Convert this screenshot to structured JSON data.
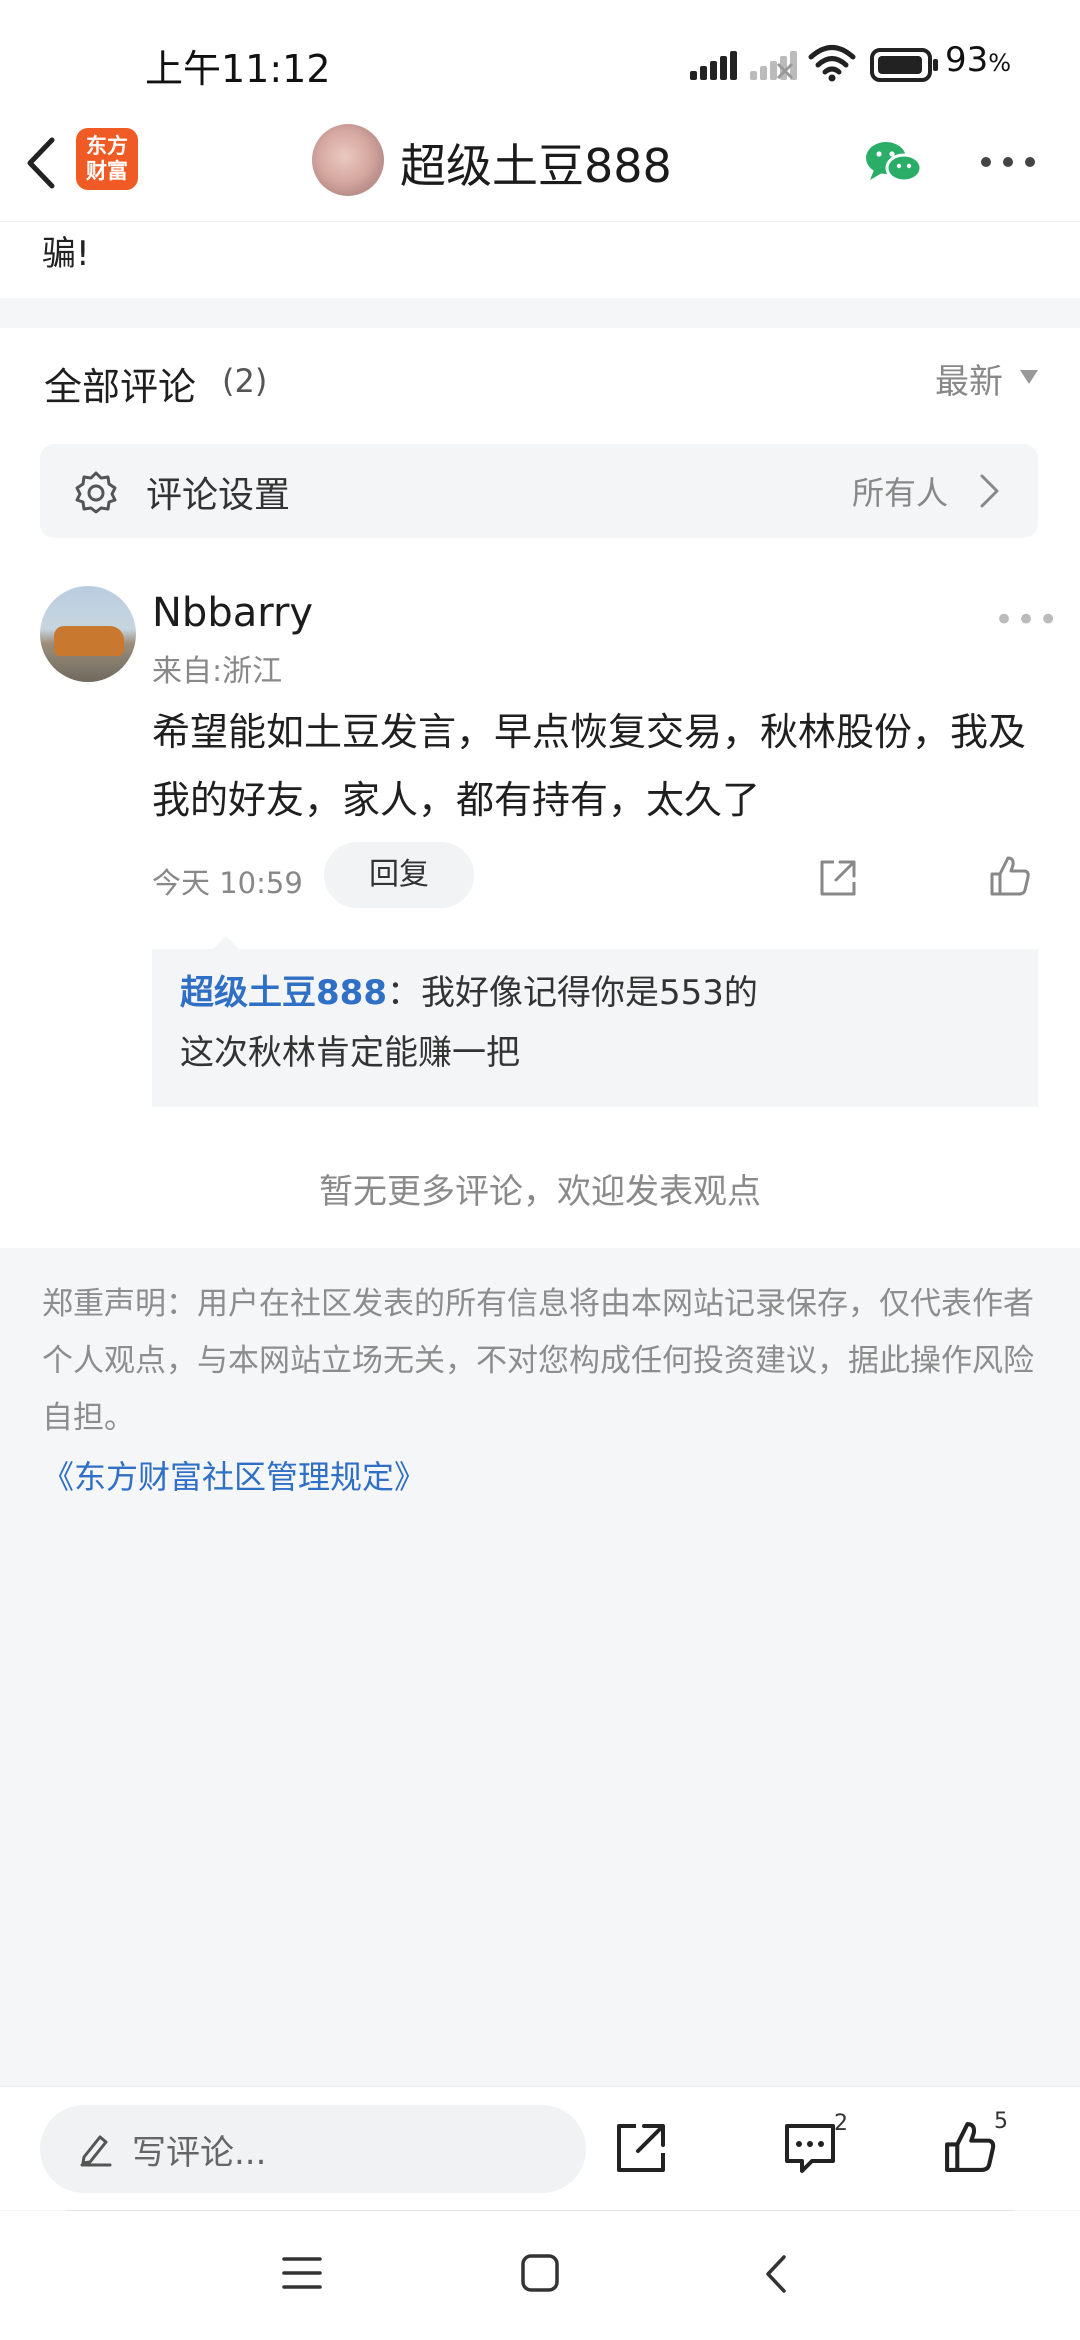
{
  "status_bar": {
    "time": "上午11:12",
    "battery_percent": "93",
    "battery_unit": "%"
  },
  "nav": {
    "logo_line1": "东方",
    "logo_line2": "财富",
    "title": "超级土豆888"
  },
  "post": {
    "fragment": "骗!"
  },
  "comments": {
    "title": "全部评论",
    "count": "(2)",
    "sort_label": "最新",
    "settings_label": "评论设置",
    "settings_value": "所有人",
    "items": [
      {
        "name": "Nbbarry",
        "location": "来自:浙江",
        "body": "希望能如土豆发言，早点恢复交易，秋林股份，我及我的好友，家人，都有持有，太久了",
        "time": "今天 10:59",
        "reply_label": "回复",
        "reply": {
          "author": "超级土豆888",
          "separator": "：",
          "line1": "我好像记得你是553的",
          "line2": "这次秋林肯定能赚一把"
        }
      }
    ],
    "no_more": "暂无更多评论，欢迎发表观点"
  },
  "disclaimer": {
    "text": "郑重声明：用户在社区发表的所有信息将由本网站记录保存，仅代表作者个人观点，与本网站立场无关，不对您构成任何投资建议，据此操作风险自担。",
    "link": "《东方财富社区管理规定》"
  },
  "bottom_bar": {
    "write_placeholder": "写评论...",
    "comment_count": "2",
    "like_count": "5"
  },
  "colors": {
    "accent_blue": "#2f6fc5",
    "logo_orange": "#f05a24",
    "wechat_green": "#2aae67"
  }
}
